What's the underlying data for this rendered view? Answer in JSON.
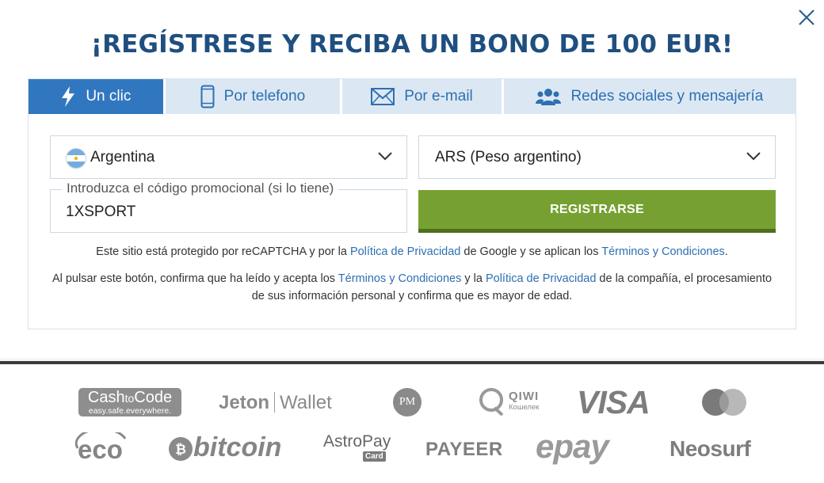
{
  "header": {
    "title": "¡REGÍSTRESE Y RECIBA UN BONO DE 100 EUR!"
  },
  "tabs": [
    {
      "label": "Un clic",
      "icon": "lightning-icon",
      "active": true
    },
    {
      "label": "Por telefono",
      "icon": "phone-icon",
      "active": false
    },
    {
      "label": "Por e-mail",
      "icon": "envelope-icon",
      "active": false
    },
    {
      "label": "Redes sociales y mensajería",
      "icon": "users-icon",
      "active": false
    }
  ],
  "form": {
    "country": "Argentina",
    "currency": "ARS (Peso argentino)",
    "promo_label": "Introduzca el código promocional (si lo tiene)",
    "promo_value": "1XSPORT",
    "register_label": "REGISTRARSE"
  },
  "notice1": {
    "t1": "Este sitio está protegido por reCAPTCHA y por la ",
    "l1": "Política de Privacidad",
    "t2": " de Google y se aplican los ",
    "l2": "Términos y Condiciones",
    "t3": "."
  },
  "notice2": {
    "t1": "Al pulsar este botón, confirma que ha leído y acepta los ",
    "l1": "Términos y Condiciones",
    "t2": " y la ",
    "l2": "Política de Privacidad",
    "t3": " de la compañía, el procesamiento de sus información personal y confirma que es mayor de edad."
  },
  "payments": {
    "cashtocode_a": "Cash",
    "cashtocode_b": "to",
    "cashtocode_c": "Code",
    "cashtocode_tag": "easy.safe.everywhere.",
    "jeton_a": "Jeton",
    "jeton_b": "Wallet",
    "pm": "PM",
    "qiwi": "QIWI",
    "qiwi_sub": "Кошелек",
    "visa": "VISA",
    "eco": "eco",
    "bitcoin": "bitcoin",
    "astropay": "AstroPay",
    "astropay_sub": "Card",
    "payeer": "PAYEER",
    "epay": "epay",
    "neosurf": "Neosurf"
  },
  "colors": {
    "title": "#1f4f7f",
    "tab_active": "#3177c0",
    "tab_inactive": "#dbe8f4",
    "register": "#76a132",
    "link": "#2e6fb0"
  }
}
